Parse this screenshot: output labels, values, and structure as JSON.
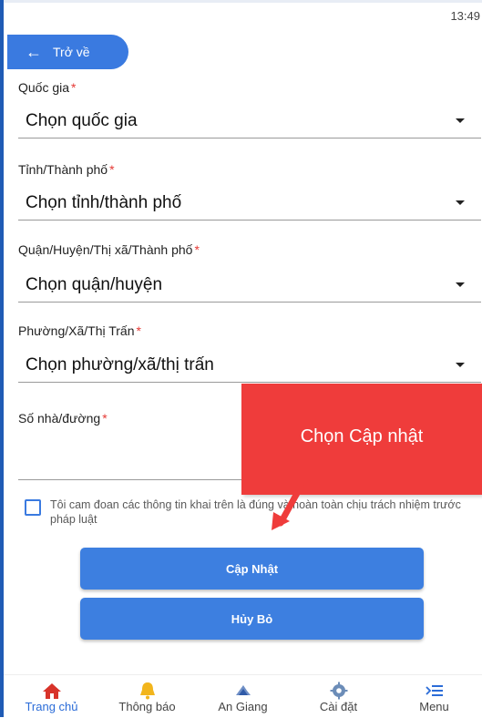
{
  "status_bar": {
    "time": "13:49"
  },
  "header": {
    "back_label": "Trở về"
  },
  "form": {
    "country": {
      "label": "Quốc gia",
      "required": "*",
      "value": "Chọn quốc gia"
    },
    "province": {
      "label": "Tỉnh/Thành phố",
      "required": "*",
      "value": "Chọn tỉnh/thành phố"
    },
    "district": {
      "label": "Quận/Huyện/Thị xã/Thành phố",
      "required": "*",
      "value": "Chọn quận/huyện"
    },
    "ward": {
      "label": "Phường/Xã/Thị Trấn",
      "required": "*",
      "value": "Chọn phường/xã/thị trấn"
    },
    "address": {
      "label": "Số nhà/đường",
      "required": "*",
      "value": ""
    },
    "commitment": "Tôi cam đoan các thông tin khai trên là đúng và hoàn toàn chịu trách nhiệm trước pháp luật",
    "update_label": "Cập Nhật",
    "cancel_label": "Hủy Bỏ"
  },
  "annotation": {
    "text": "Chọn Cập nhật"
  },
  "colors": {
    "primary": "#3d7fe0",
    "required": "#e53935",
    "annotation": "#ef3c3b"
  },
  "tabbar": {
    "items": [
      {
        "label": "Trang chủ",
        "icon": "home-icon",
        "active": true
      },
      {
        "label": "Thông báo",
        "icon": "bell-icon",
        "active": false
      },
      {
        "label": "An Giang",
        "icon": "logo-icon",
        "active": false
      },
      {
        "label": "Cài đặt",
        "icon": "gear-icon",
        "active": false
      },
      {
        "label": "Menu",
        "icon": "menu-icon",
        "active": false
      }
    ]
  }
}
